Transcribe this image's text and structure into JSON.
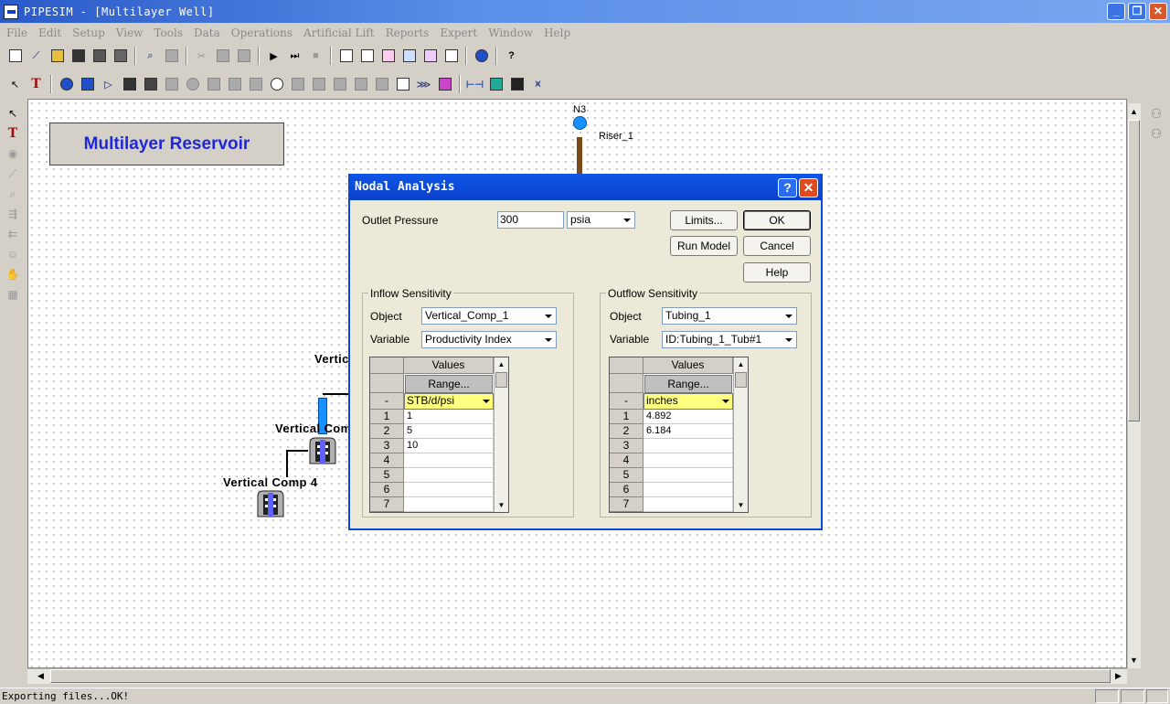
{
  "window": {
    "title": "PIPESIM - [Multilayer Well]"
  },
  "menu": [
    "File",
    "Edit",
    "Setup",
    "View",
    "Tools",
    "Data",
    "Operations",
    "Artificial Lift",
    "Reports",
    "Expert",
    "Window",
    "Help"
  ],
  "status": {
    "text": "Exporting files...OK!"
  },
  "diagram": {
    "title": "Multilayer Reservoir",
    "node": "N3",
    "riser": "Riser_1",
    "comp_top": "Vertic",
    "comp_mid": "Vertical Com",
    "comp_bottom": "Vertical Comp 4"
  },
  "dialog": {
    "title": "Nodal Analysis",
    "outlet_pressure_label": "Outlet Pressure",
    "outlet_pressure_value": "300",
    "outlet_pressure_unit": "psia",
    "buttons": {
      "limits": "Limits...",
      "ok": "OK",
      "run_model": "Run Model",
      "cancel": "Cancel",
      "help": "Help"
    },
    "inflow": {
      "title": "Inflow Sensitivity",
      "object_label": "Object",
      "object_value": "Vertical_Comp_1",
      "variable_label": "Variable",
      "variable_value": "Productivity Index",
      "grid": {
        "header": "Values",
        "range": "Range...",
        "unit_row_label": "-",
        "units": "STB/d/psi",
        "rows": [
          {
            "n": "1",
            "v": "1"
          },
          {
            "n": "2",
            "v": "5"
          },
          {
            "n": "3",
            "v": "10"
          },
          {
            "n": "4",
            "v": ""
          },
          {
            "n": "5",
            "v": ""
          },
          {
            "n": "6",
            "v": ""
          },
          {
            "n": "7",
            "v": ""
          }
        ]
      }
    },
    "outflow": {
      "title": "Outflow Sensitivity",
      "object_label": "Object",
      "object_value": "Tubing_1",
      "variable_label": "Variable",
      "variable_value": "ID:Tubing_1_Tub#1",
      "grid": {
        "header": "Values",
        "range": "Range...",
        "unit_row_label": "-",
        "units": "inches",
        "rows": [
          {
            "n": "1",
            "v": "4.892"
          },
          {
            "n": "2",
            "v": "6.184"
          },
          {
            "n": "3",
            "v": ""
          },
          {
            "n": "4",
            "v": ""
          },
          {
            "n": "5",
            "v": ""
          },
          {
            "n": "6",
            "v": ""
          },
          {
            "n": "7",
            "v": ""
          }
        ]
      }
    }
  },
  "colors": {
    "title_bar": "#2a5ac8",
    "dialog_title": "#0f56e8",
    "diagram_title": "#1e28d6",
    "units_cell": "#ffff80"
  }
}
